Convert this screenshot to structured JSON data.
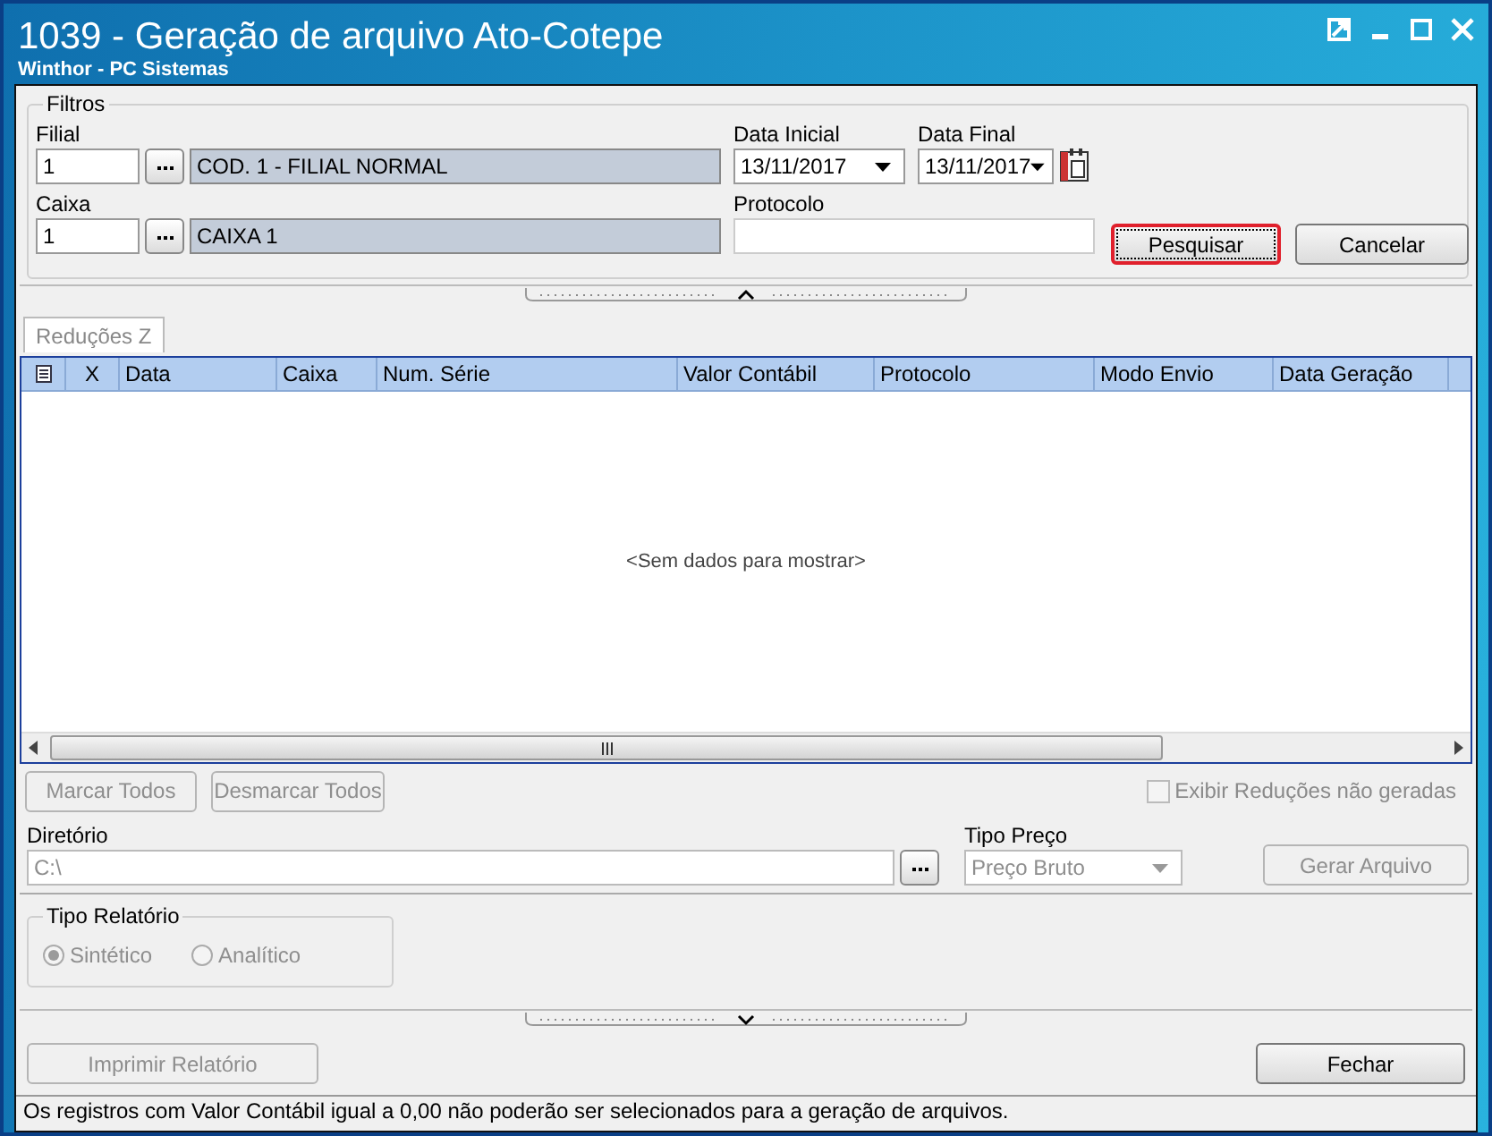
{
  "window": {
    "title": "1039 - Geração de arquivo Ato-Cotepe",
    "subtitle": "Winthor - PC Sistemas"
  },
  "filters": {
    "legend": "Filtros",
    "filial": {
      "label": "Filial",
      "code": "1",
      "description": "COD. 1 - FILIAL NORMAL"
    },
    "caixa": {
      "label": "Caixa",
      "code": "1",
      "description": "CAIXA 1"
    },
    "data_inicial": {
      "label": "Data Inicial",
      "value": "13/11/2017"
    },
    "data_final": {
      "label": "Data Final",
      "value": "13/11/2017"
    },
    "protocolo": {
      "label": "Protocolo"
    },
    "buttons": [
      {
        "label": "Pesquisar",
        "focused": true
      },
      {
        "label": "Cancelar",
        "focused": false
      }
    ]
  },
  "tabs": [
    {
      "label": "Reduções Z",
      "selected": true
    }
  ],
  "table": {
    "columns": [
      "X",
      "Data",
      "Caixa",
      "Num. Série",
      "Valor Contábil",
      "Protocolo",
      "Modo Envio",
      "Data Geração"
    ],
    "empty_message": "<Sem dados para mostrar>"
  },
  "selection_buttons": [
    {
      "label": "Marcar Todos",
      "disabled": true
    },
    {
      "label": "Desmarcar Todos",
      "disabled": true
    }
  ],
  "show_unsent": {
    "label": "Exibir Reduções não geradas",
    "checked": false,
    "disabled": true
  },
  "diretorio": {
    "label": "Diretório",
    "value": "C:\\",
    "disabled": true
  },
  "tipo_preco": {
    "label": "Tipo Preço",
    "value": "Preço Bruto",
    "disabled": true
  },
  "generate_button": {
    "label": "Gerar Arquivo",
    "disabled": true
  },
  "tipo_relatorio": {
    "legend": "Tipo Relatório",
    "options": [
      {
        "label": "Sintético",
        "selected": true,
        "disabled": true
      },
      {
        "label": "Analítico",
        "selected": false,
        "disabled": true
      }
    ]
  },
  "print_button": {
    "label": "Imprimir Relatório",
    "disabled": true
  },
  "close_button": {
    "label": "Fechar",
    "disabled": false
  },
  "status_bar": "Os registros com Valor Contábil igual a 0,00 não poderão ser selecionados para a geração de arquivos."
}
